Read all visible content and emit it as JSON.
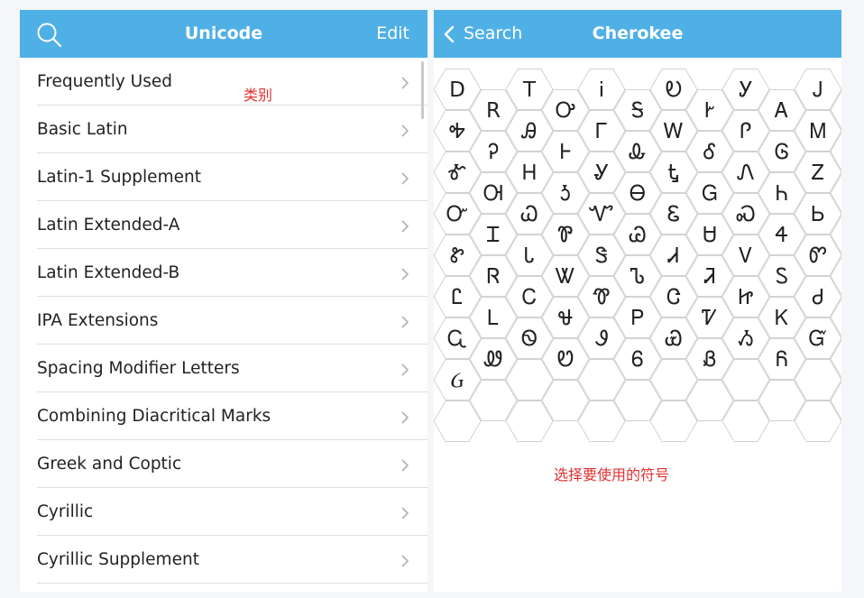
{
  "left_panel": {
    "title": "Unicode",
    "edit_label": "Edit",
    "categories": [
      "Frequently Used",
      "Basic Latin",
      "Latin-1 Supplement",
      "Latin Extended-A",
      "Latin Extended-B",
      "IPA Extensions",
      "Spacing Modifier Letters",
      "Combining Diacritical Marks",
      "Greek and Coptic",
      "Cyrillic",
      "Cyrillic Supplement"
    ],
    "annotation": "类别"
  },
  "right_panel": {
    "back_label": "Search",
    "title": "Cherokee",
    "annotation": "选择要使用的符号",
    "symbol_rows": [
      [
        "D",
        "R",
        "T",
        "Ꭴ",
        "Ꭵ",
        "Ꭶ"
      ],
      [
        "Ꭷ",
        "Ꭸ",
        "Ꭹ",
        "Ꭺ",
        "Ꭻ",
        "Ꭼ",
        "Ꭽ",
        "Ꭾ",
        "Ꭿ",
        "Ꮀ",
        "Ꮁ",
        "Ꮂ"
      ],
      [
        "Ꮃ",
        "Ꮄ",
        "Ꮅ",
        "Ꮆ",
        "Ꮇ",
        "Ꮈ",
        "Ꮉ",
        "Ꮊ",
        "Ꮋ",
        "Ꮌ",
        "Ꮍ",
        "Ꮎ"
      ],
      [
        "Ꮏ",
        "Ꮐ",
        "Ꮑ",
        "Ꮒ",
        "Ꮓ",
        "Ꮔ",
        "Ꮕ",
        "Ꮖ",
        "Ꮗ",
        "Ꮘ",
        "Ꮙ",
        "Ꮚ"
      ],
      [
        "Ꮛ",
        "Ꮜ",
        "Ꮝ",
        "Ꮞ",
        "Ꮟ",
        "Ꮠ",
        "Ꮡ",
        "Ꮢ",
        "Ꮣ",
        "Ꮤ",
        "Ꮥ",
        "Ꮦ"
      ],
      [
        "Ꮧ",
        "Ꮨ",
        "Ꮩ",
        "Ꮪ",
        "Ꮫ",
        "Ꮬ",
        "Ꮭ",
        "Ꮮ",
        "Ꮯ",
        "Ꮰ",
        "Ꮱ",
        "Ꮲ"
      ],
      [
        "Ꮳ",
        "Ꮴ",
        "Ꮵ",
        "Ꮶ",
        "Ꮷ",
        "Ꮸ",
        "Ꮹ",
        "Ꮺ",
        "Ꮻ",
        "Ꮼ",
        "Ꮽ",
        "Ꮾ"
      ],
      [
        "Ꮿ",
        "Ᏸ",
        "Ᏹ",
        "Ᏺ",
        "Ᏻ",
        "Ᏼ",
        "Ᏽ",
        "",
        ""
      ]
    ]
  },
  "colors": {
    "accent": "#4fb0e6",
    "annotation": "#e03030",
    "separator": "#dedede",
    "chevron": "#b5b5b5",
    "hex_stroke": "#d2d2d2"
  },
  "icons": {
    "search": "search-icon",
    "back": "chevron-left-icon",
    "disclosure": "chevron-right-icon"
  }
}
